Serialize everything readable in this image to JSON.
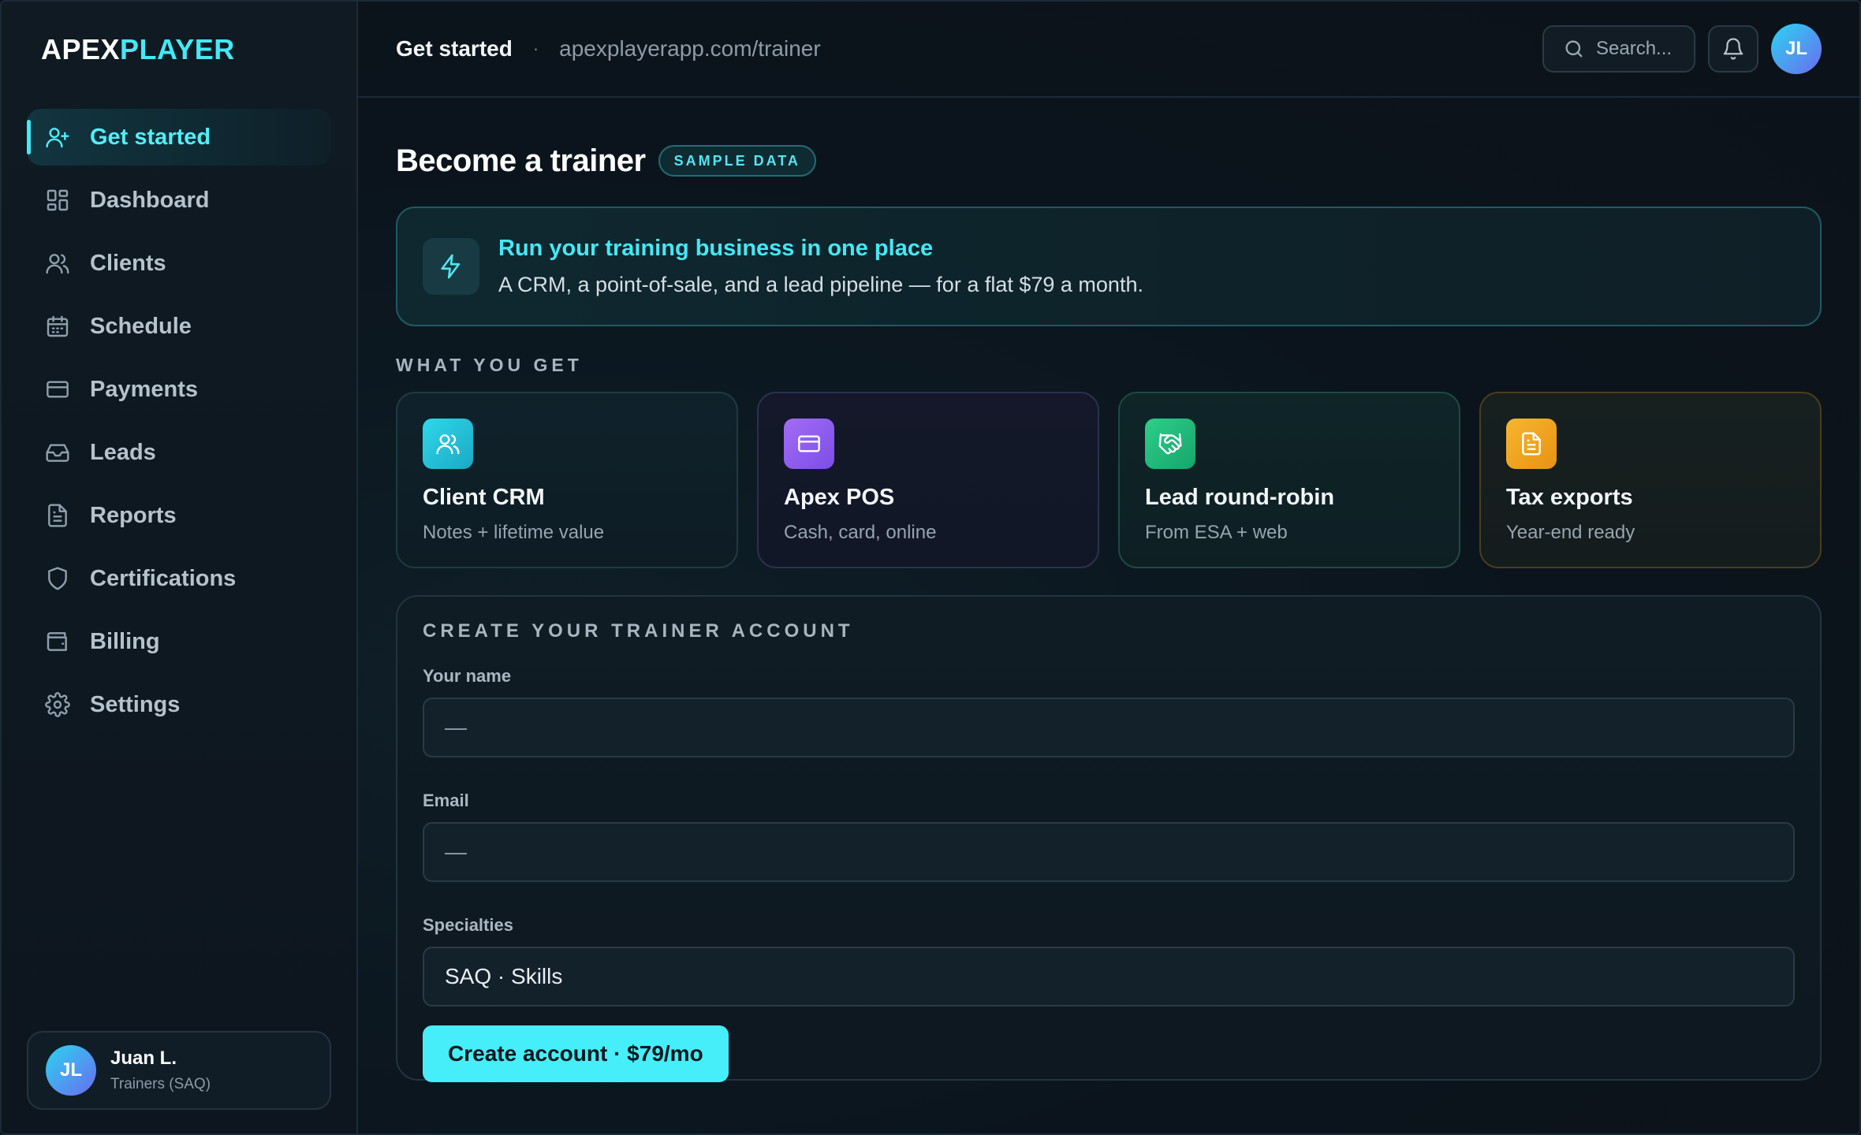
{
  "brand": {
    "part1": "APEX",
    "part2": "PLAYER",
    "accent": "#45e8f5"
  },
  "sidebar": {
    "items": [
      {
        "label": "Get started",
        "icon": "user-plus-icon",
        "active": true
      },
      {
        "label": "Dashboard",
        "icon": "dashboard-icon"
      },
      {
        "label": "Clients",
        "icon": "users-icon"
      },
      {
        "label": "Schedule",
        "icon": "calendar-icon"
      },
      {
        "label": "Payments",
        "icon": "credit-card-icon"
      },
      {
        "label": "Leads",
        "icon": "inbox-icon"
      },
      {
        "label": "Reports",
        "icon": "document-icon"
      },
      {
        "label": "Certifications",
        "icon": "shield-icon"
      },
      {
        "label": "Billing",
        "icon": "wallet-icon"
      },
      {
        "label": "Settings",
        "icon": "gear-icon"
      }
    ],
    "user": {
      "initials": "JL",
      "name": "Juan L.",
      "role": "Trainers (SAQ)"
    }
  },
  "header": {
    "title": "Get started",
    "separator": "·",
    "url": "apexplayerapp.com/trainer",
    "search_placeholder": "Search...",
    "avatar_initials": "JL"
  },
  "page": {
    "title": "Become a trainer",
    "badge": "SAMPLE DATA",
    "banner": {
      "title": "Run your training business in one place",
      "subtitle": "A CRM, a point-of-sale, and a lead pipeline — for a flat $79 a month."
    },
    "features_heading": "WHAT YOU GET",
    "features": [
      {
        "title": "Client CRM",
        "subtitle": "Notes + lifetime value",
        "icon": "users-icon",
        "color": "#2fd8ea"
      },
      {
        "title": "Apex POS",
        "subtitle": "Cash, card, online",
        "icon": "credit-card-icon",
        "color": "#a36cf3"
      },
      {
        "title": "Lead round-robin",
        "subtitle": "From ESA + web",
        "icon": "handshake-icon",
        "color": "#2fce8a"
      },
      {
        "title": "Tax exports",
        "subtitle": "Year-end ready",
        "icon": "document-icon",
        "color": "#f6b531"
      }
    ],
    "form": {
      "heading": "CREATE YOUR TRAINER ACCOUNT",
      "name_label": "Your name",
      "name_value": "—",
      "email_label": "Email",
      "email_value": "—",
      "specialties_label": "Specialties",
      "specialties_value": "SAQ · Skills",
      "submit_label": "Create account · $79/mo"
    }
  }
}
